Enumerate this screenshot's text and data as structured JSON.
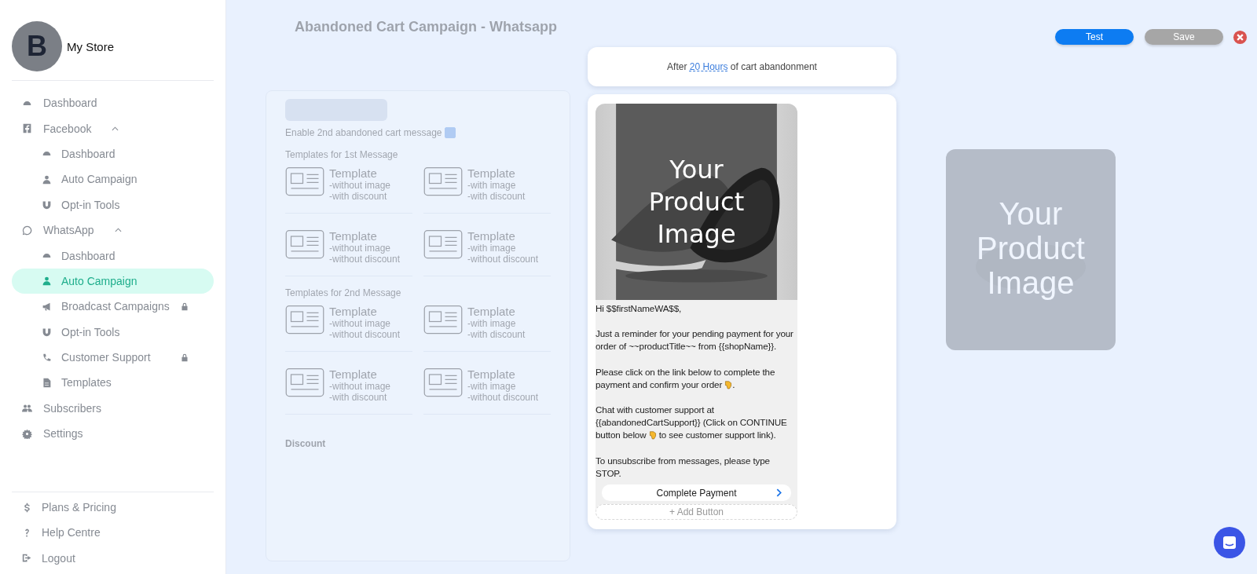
{
  "sidebar": {
    "store": {
      "initial": "B",
      "name": "My Store"
    },
    "items": [
      {
        "label": "Dashboard",
        "selected": false
      },
      {
        "label": "Facebook",
        "selected": false,
        "expanded": true,
        "children": [
          {
            "label": "Dashboard",
            "selected": false,
            "locked": false
          },
          {
            "label": "Auto Campaign",
            "selected": false,
            "locked": false
          },
          {
            "label": "Opt-in Tools",
            "selected": false,
            "locked": false
          }
        ]
      },
      {
        "label": "WhatsApp",
        "selected": false,
        "expanded": true,
        "children": [
          {
            "label": "Dashboard",
            "selected": false,
            "locked": false
          },
          {
            "label": "Auto Campaign",
            "selected": true,
            "locked": false
          },
          {
            "label": "Broadcast Campaigns",
            "selected": false,
            "locked": true
          },
          {
            "label": "Opt-in Tools",
            "selected": false,
            "locked": false
          },
          {
            "label": "Customer Support",
            "selected": false,
            "locked": true
          },
          {
            "label": "Templates",
            "selected": false,
            "locked": false
          }
        ]
      },
      {
        "label": "Subscribers",
        "selected": false
      },
      {
        "label": "Settings",
        "selected": false
      }
    ],
    "footer_items": [
      {
        "label": "Plans & Pricing"
      },
      {
        "label": "Help Centre"
      },
      {
        "label": "Logout"
      }
    ]
  },
  "page": {
    "title": "Abandoned Cart Campaign - Whatsapp",
    "enable_label": "Enable 2nd abandoned cart message",
    "enabled": true,
    "sections": [
      {
        "heading": "Templates for 1st Message",
        "templates": [
          {
            "title": "Template",
            "lines": [
              "-without image",
              "-with discount"
            ]
          },
          {
            "title": "Template",
            "lines": [
              "-with image",
              "-with discount"
            ]
          },
          {
            "title": "Template",
            "lines": [
              "-without image",
              "-without discount"
            ]
          },
          {
            "title": "Template",
            "lines": [
              "-with image",
              "-without discount"
            ]
          }
        ]
      },
      {
        "heading": "Templates for 2nd Message",
        "templates": [
          {
            "title": "Template",
            "lines": [
              "-without image",
              "-without discount"
            ]
          },
          {
            "title": "Template",
            "lines": [
              "-with image",
              "-with discount"
            ]
          },
          {
            "title": "Template",
            "lines": [
              "-without image",
              "-with discount"
            ]
          },
          {
            "title": "Template",
            "lines": [
              "-with image",
              "-without discount"
            ]
          }
        ]
      }
    ],
    "discount_heading": "Discount",
    "side_preview_caption": "Your Product Image"
  },
  "modal": {
    "actions": [
      {
        "label": "Test",
        "kind": "primary"
      },
      {
        "label": "Save",
        "kind": "secondary"
      }
    ],
    "timing": {
      "prefix": "After",
      "value": "20 Hours",
      "suffix": "of cart abandonment"
    },
    "preview": {
      "image_caption": "Your Product Image",
      "paragraphs": [
        [
          {
            "kind": "text",
            "text": "Hi $$firstNameWA$$,"
          }
        ],
        [
          {
            "kind": "text",
            "text": "Just a reminder for your pending payment for your order of ~~productTitle~~ from {{shopName}}."
          }
        ],
        [
          {
            "kind": "text",
            "text": "Please click on the link below to complete the payment and confirm your order "
          },
          {
            "kind": "hand"
          },
          {
            "kind": "text",
            "text": "."
          }
        ],
        [
          {
            "kind": "text",
            "text": "Chat with customer support at {{abandonedCartSupport}} (Click on CONTINUE button below "
          },
          {
            "kind": "hand"
          },
          {
            "kind": "text",
            "text": " to see customer support link)."
          }
        ],
        [
          {
            "kind": "text",
            "text": "To unsubscribe from messages, please type STOP."
          }
        ]
      ],
      "button": "Complete Payment",
      "add_button": "+ Add Button"
    }
  }
}
